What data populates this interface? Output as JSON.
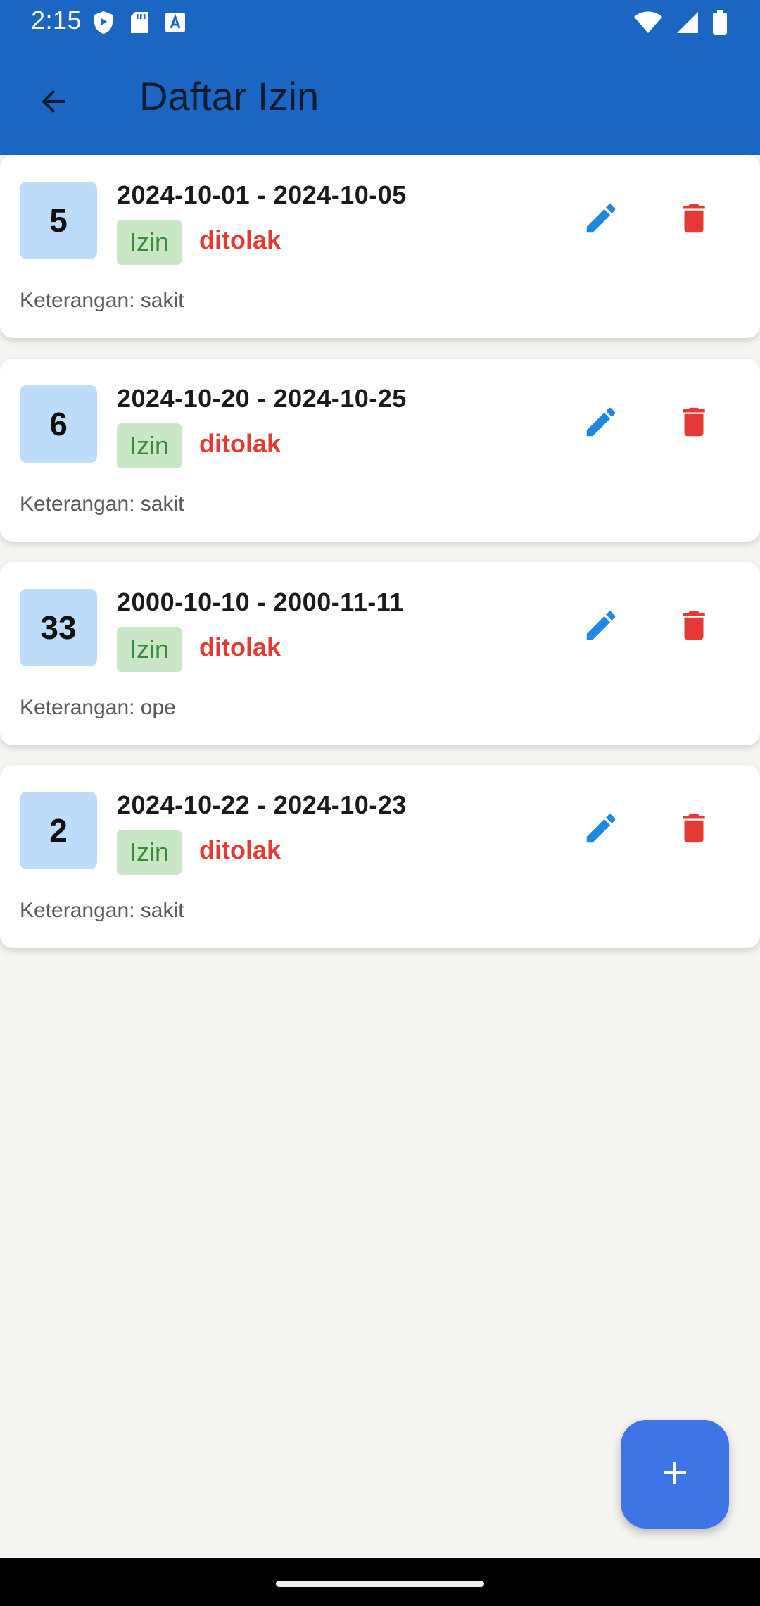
{
  "status_bar": {
    "time": "2:15",
    "left_icons": [
      "shield-icon",
      "sd-card-icon",
      "font-a-icon"
    ],
    "right_icons": [
      "wifi-icon",
      "signal-icon",
      "battery-icon"
    ]
  },
  "app_bar": {
    "title": "Daftar Izin",
    "back_icon": "arrow-back-icon"
  },
  "items": [
    {
      "id": "5",
      "date_range": "2024-10-01 - 2024-10-05",
      "type": "Izin",
      "status": "ditolak",
      "note": "Keterangan: sakit"
    },
    {
      "id": "6",
      "date_range": "2024-10-20 - 2024-10-25",
      "type": "Izin",
      "status": "ditolak",
      "note": "Keterangan: sakit"
    },
    {
      "id": "33",
      "date_range": "2000-10-10 - 2000-11-11",
      "type": "Izin",
      "status": "ditolak",
      "note": "Keterangan: ope"
    },
    {
      "id": "2",
      "date_range": "2024-10-22 - 2024-10-23",
      "type": "Izin",
      "status": "ditolak",
      "note": "Keterangan: sakit"
    }
  ],
  "fab": {
    "icon": "plus-icon"
  },
  "colors": {
    "app_bar": "#1c66c3",
    "background": "#f6f5f2",
    "id_badge": "#bcdcfa",
    "type_chip_bg": "#c9e7c6",
    "type_chip_text": "#3a8a3a",
    "status_rejected": "#e53935",
    "edit_icon": "#1e88e5",
    "delete_icon": "#e53935",
    "fab": "#3d74e6"
  }
}
